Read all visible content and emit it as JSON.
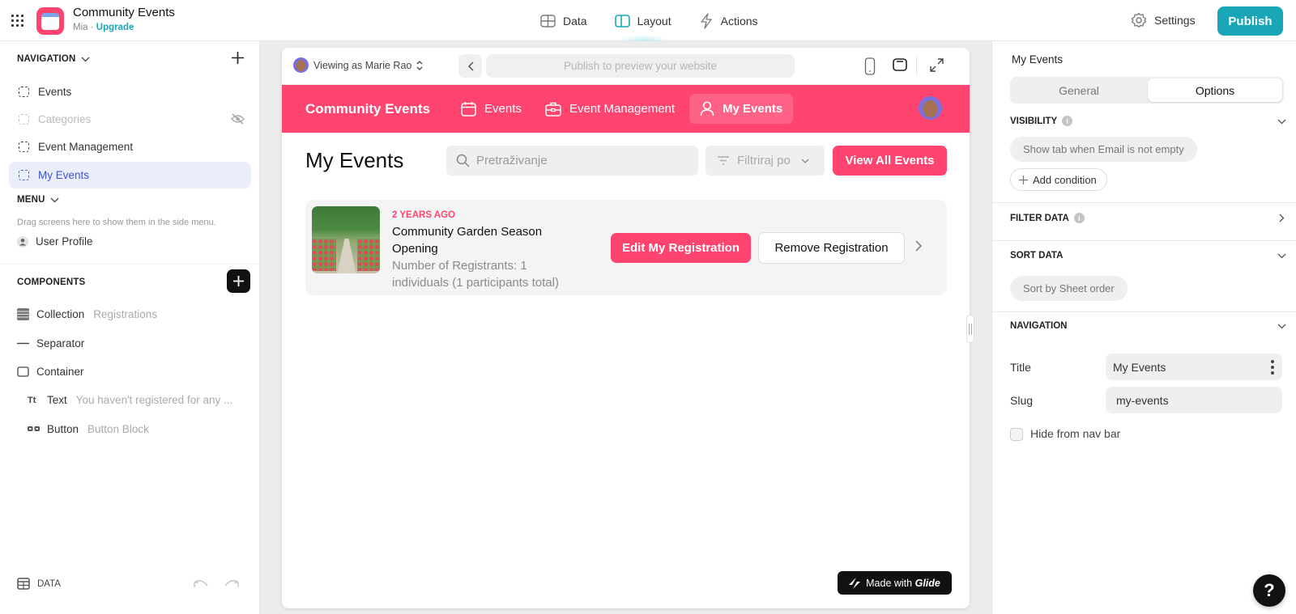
{
  "topbar": {
    "app_title": "Community Events",
    "owner": "Mia",
    "separator": "·",
    "upgrade_label": "Upgrade",
    "tabs": [
      {
        "label": "Data",
        "icon": "table-icon"
      },
      {
        "label": "Layout",
        "icon": "layout-icon",
        "active": true
      },
      {
        "label": "Actions",
        "icon": "lightning-icon"
      }
    ],
    "settings_label": "Settings",
    "publish_label": "Publish",
    "accent_color": "#19a7b8"
  },
  "left_panel": {
    "navigation_heading": "NAVIGATION",
    "nav_items": [
      {
        "label": "Events",
        "state": "normal"
      },
      {
        "label": "Categories",
        "state": "hidden"
      },
      {
        "label": "Event Management",
        "state": "normal"
      },
      {
        "label": "My Events",
        "state": "selected"
      }
    ],
    "menu_heading": "MENU",
    "menu_hint": "Drag screens here to show them in the side menu.",
    "menu_items": [
      {
        "label": "User Profile"
      }
    ],
    "components_heading": "COMPONENTS",
    "components": [
      {
        "label": "Collection",
        "sub": "Registrations",
        "icon": "collection-icon"
      },
      {
        "label": "Separator",
        "sub": "",
        "icon": "separator-icon"
      },
      {
        "label": "Container",
        "sub": "",
        "icon": "container-icon"
      },
      {
        "label": "Text",
        "sub": "You haven't registered for any ...",
        "icon": "text-icon"
      },
      {
        "label": "Button",
        "sub": "Button Block",
        "icon": "button-icon"
      }
    ],
    "data_label": "DATA"
  },
  "preview": {
    "viewing_as": "Viewing as Marie Rao",
    "url_placeholder": "Publish to preview your website",
    "app_brand": "Community Events",
    "app_tabs": [
      {
        "label": "Events",
        "icon": "calendar-icon"
      },
      {
        "label": "Event Management",
        "icon": "briefcase-icon"
      },
      {
        "label": "My Events",
        "icon": "user-icon",
        "active": true
      }
    ],
    "page_title": "My Events",
    "search_placeholder": "Pretraživanje",
    "filter_label": "Filtriraj po",
    "view_all_label": "View All Events",
    "card": {
      "time_ago": "2 YEARS AGO",
      "title": "Community Garden Season Opening",
      "subtitle": "Number of Registrants: 1 individuals (1 participants total)",
      "edit_label": "Edit My Registration",
      "remove_label": "Remove Registration"
    },
    "made_with": "Made with",
    "made_with_brand": "Glide",
    "brand_color": "#ff4470"
  },
  "right_panel": {
    "title": "My Events",
    "tabs": [
      {
        "label": "General"
      },
      {
        "label": "Options",
        "active": true
      }
    ],
    "visibility_heading": "VISIBILITY",
    "visibility_condition": "Show tab when Email is not empty",
    "add_condition_label": "Add condition",
    "filter_heading": "FILTER DATA",
    "sort_heading": "SORT DATA",
    "sort_value": "Sort by Sheet order",
    "navigation_heading": "NAVIGATION",
    "title_label": "Title",
    "title_value": "My Events",
    "slug_label": "Slug",
    "slug_value": "my-events",
    "hide_nav_label": "Hide from nav bar",
    "hide_nav_checked": false
  },
  "help_label": "?"
}
